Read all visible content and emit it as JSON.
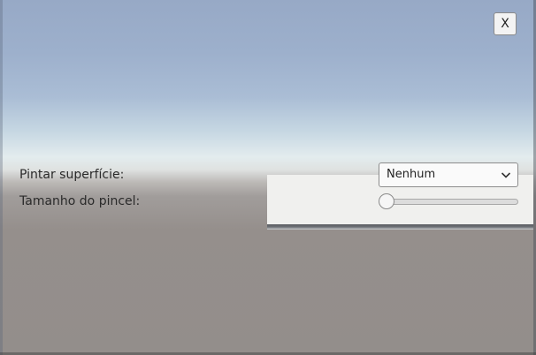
{
  "close_button": {
    "label": "X"
  },
  "paint_surface": {
    "label": "Pintar superfície:",
    "selected": "Nenhum"
  },
  "brush_size": {
    "label": "Tamanho do pincel:",
    "level": 0
  }
}
